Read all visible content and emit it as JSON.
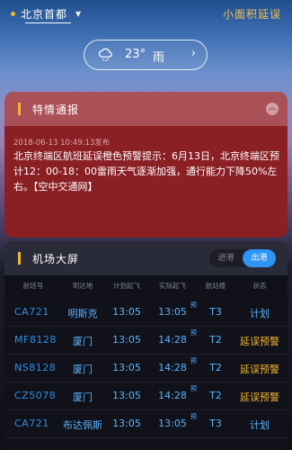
{
  "header": {
    "city": "北京首都",
    "delay_link": "小面积延误"
  },
  "weather": {
    "icon": "rain-cloud-icon",
    "temperature": "23°",
    "condition": "雨",
    "arrow": "›"
  },
  "alert": {
    "title": "特情通报",
    "time": "2018-06-13 10:49:13发布",
    "text": "北京终端区航班延误橙色预警提示：6月13日，北京终端区预计12：00-18：00雷雨天气逐渐加强，通行能力下降50%左右。【空中交通网】"
  },
  "board": {
    "title": "机场大屏",
    "tabs": [
      "进港",
      "出港"
    ],
    "active_tab": "出港",
    "columns": [
      "航班号",
      "到达地",
      "计划起飞",
      "实际起飞",
      "航站楼",
      "状态"
    ],
    "predict_mark": "预",
    "rows": [
      {
        "flight": "CA721",
        "dest": "明斯克",
        "scheduled": "13:05",
        "actual": "13:05",
        "terminal": "T3",
        "status": "计划",
        "status_color": "#5ab3ff"
      },
      {
        "flight": "MF8128",
        "dest": "厦门",
        "scheduled": "13:05",
        "actual": "14:28",
        "terminal": "T2",
        "status": "延误预警",
        "status_color": "#f2b632"
      },
      {
        "flight": "NS8128",
        "dest": "厦门",
        "scheduled": "13:05",
        "actual": "14:28",
        "terminal": "T2",
        "status": "延误预警",
        "status_color": "#f2b632"
      },
      {
        "flight": "CZ5078",
        "dest": "厦门",
        "scheduled": "13:05",
        "actual": "14:28",
        "terminal": "T2",
        "status": "延误预警",
        "status_color": "#f2b632"
      },
      {
        "flight": "CA721",
        "dest": "布达佩斯",
        "scheduled": "13:05",
        "actual": "13:05",
        "terminal": "T3",
        "status": "计划",
        "status_color": "#5ab3ff"
      }
    ]
  }
}
